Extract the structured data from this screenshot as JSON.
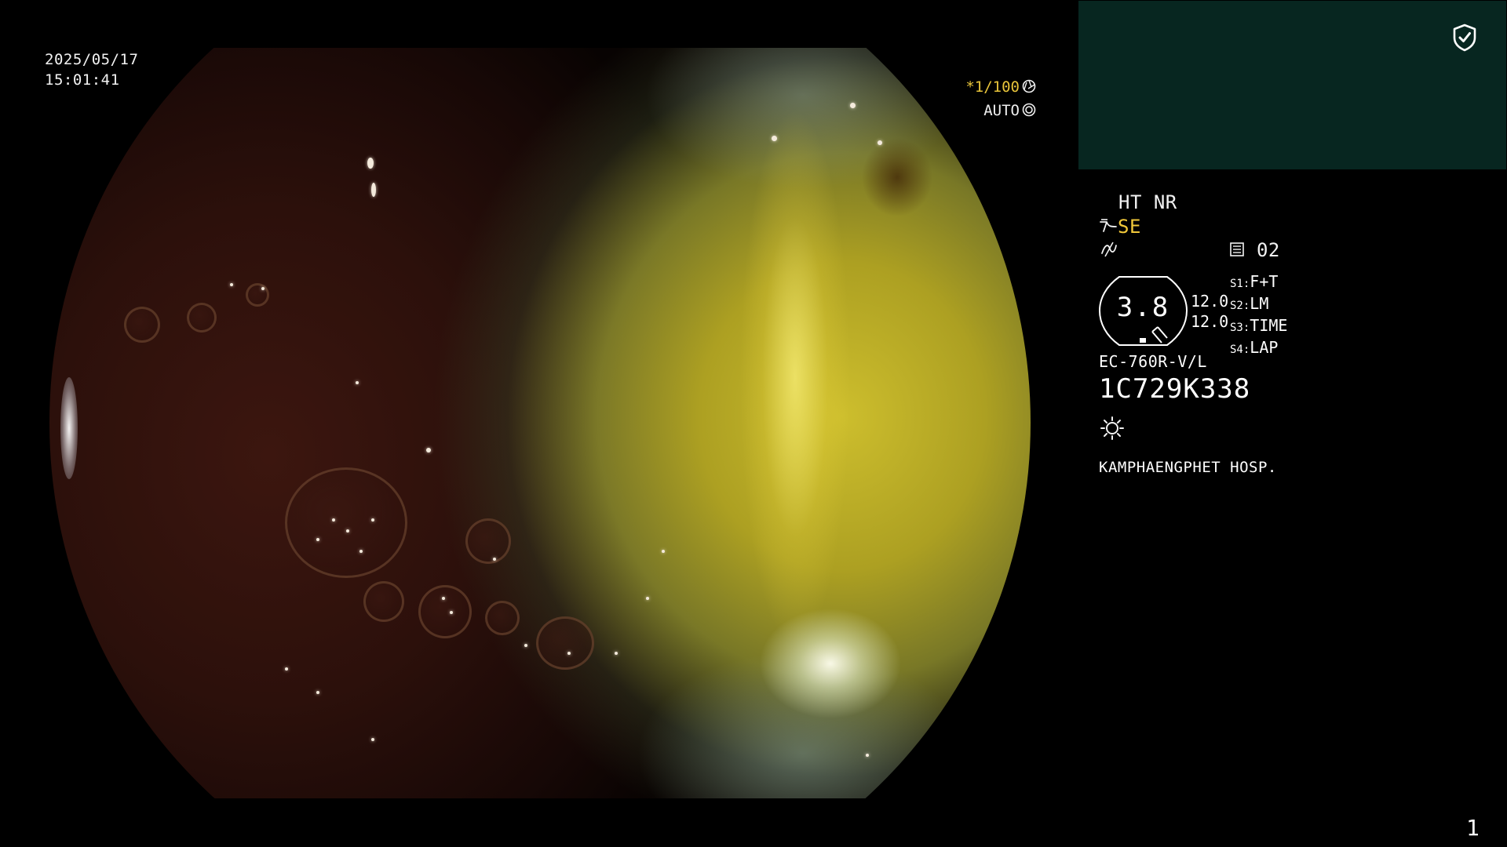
{
  "overlay": {
    "date": "2025/05/17",
    "time": "15:01:41",
    "shutter": "*1/100",
    "iris_mode": "AUTO",
    "shutter_icon": "aperture-icon",
    "iris_icon": "iris-icon"
  },
  "panel": {
    "status_icon": "shield-check-icon",
    "enhancement": "HT NR",
    "structure_mode": "SE",
    "structure_icon": "structure-enhance-icon",
    "color_icon": "color-mode-icon",
    "image_slot": "02",
    "image_slot_icon": "memory-card-icon",
    "zoom_value": "3.8",
    "scale_top": "12.0",
    "scale_bottom": "12.0",
    "switches": [
      {
        "label": "S1:",
        "value": "F+T"
      },
      {
        "label": "S2:",
        "value": "LM"
      },
      {
        "label": "S3:",
        "value": "TIME"
      },
      {
        "label": "S4:",
        "value": "LAP"
      }
    ],
    "scope_model": "EC-760R-V/L",
    "scope_serial": "1C729K338",
    "light_icon": "light-source-icon",
    "hospital": "KAMPHAENGPHET HOSP."
  },
  "page_number": "1",
  "colors": {
    "background": "#000000",
    "thumbnail_bg": "#072620",
    "accent_yellow": "#f1c83a",
    "text": "#f2f2f2"
  }
}
